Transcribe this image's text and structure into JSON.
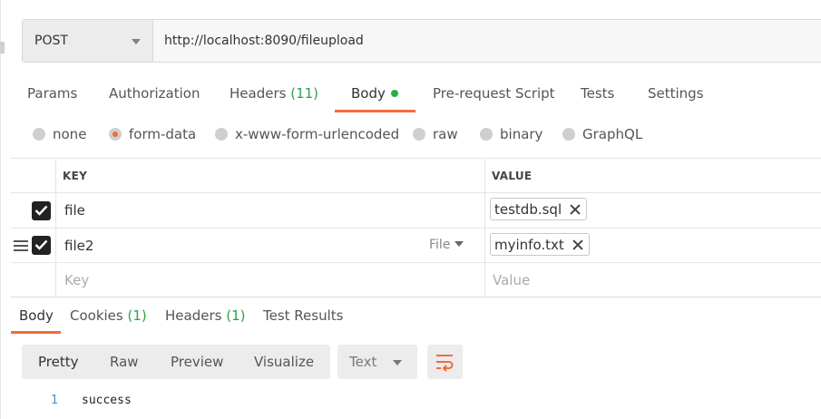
{
  "request": {
    "method": "POST",
    "url": "http://localhost:8090/fileupload"
  },
  "request_tabs": [
    {
      "label": "Params"
    },
    {
      "label": "Authorization"
    },
    {
      "label": "Headers",
      "count": "(11)"
    },
    {
      "label": "Body"
    },
    {
      "label": "Pre-request Script"
    },
    {
      "label": "Tests"
    },
    {
      "label": "Settings"
    }
  ],
  "body_types": [
    {
      "label": "none",
      "selected": false
    },
    {
      "label": "form-data",
      "selected": true
    },
    {
      "label": "x-www-form-urlencoded",
      "selected": false
    },
    {
      "label": "raw",
      "selected": false
    },
    {
      "label": "binary",
      "selected": false
    },
    {
      "label": "GraphQL",
      "selected": false
    }
  ],
  "table": {
    "headers": {
      "key": "KEY",
      "value": "VALUE"
    },
    "rows": [
      {
        "key": "file",
        "value": "testdb.sql",
        "checked": true
      },
      {
        "key": "file2",
        "value": "myinfo.txt",
        "checked": true,
        "type": "File"
      }
    ],
    "placeholders": {
      "key": "Key",
      "value": "Value"
    }
  },
  "response_tabs": [
    {
      "label": "Body"
    },
    {
      "label": "Cookies",
      "count": "(1)"
    },
    {
      "label": "Headers",
      "count": "(1)"
    },
    {
      "label": "Test Results"
    }
  ],
  "view_modes": [
    "Pretty",
    "Raw",
    "Preview",
    "Visualize"
  ],
  "language": "Text",
  "response_body": {
    "line_number": "1",
    "text": "success"
  },
  "colors": {
    "accent": "#f26b3a",
    "count_green": "#2aa34a",
    "dot_green": "#26b047"
  }
}
